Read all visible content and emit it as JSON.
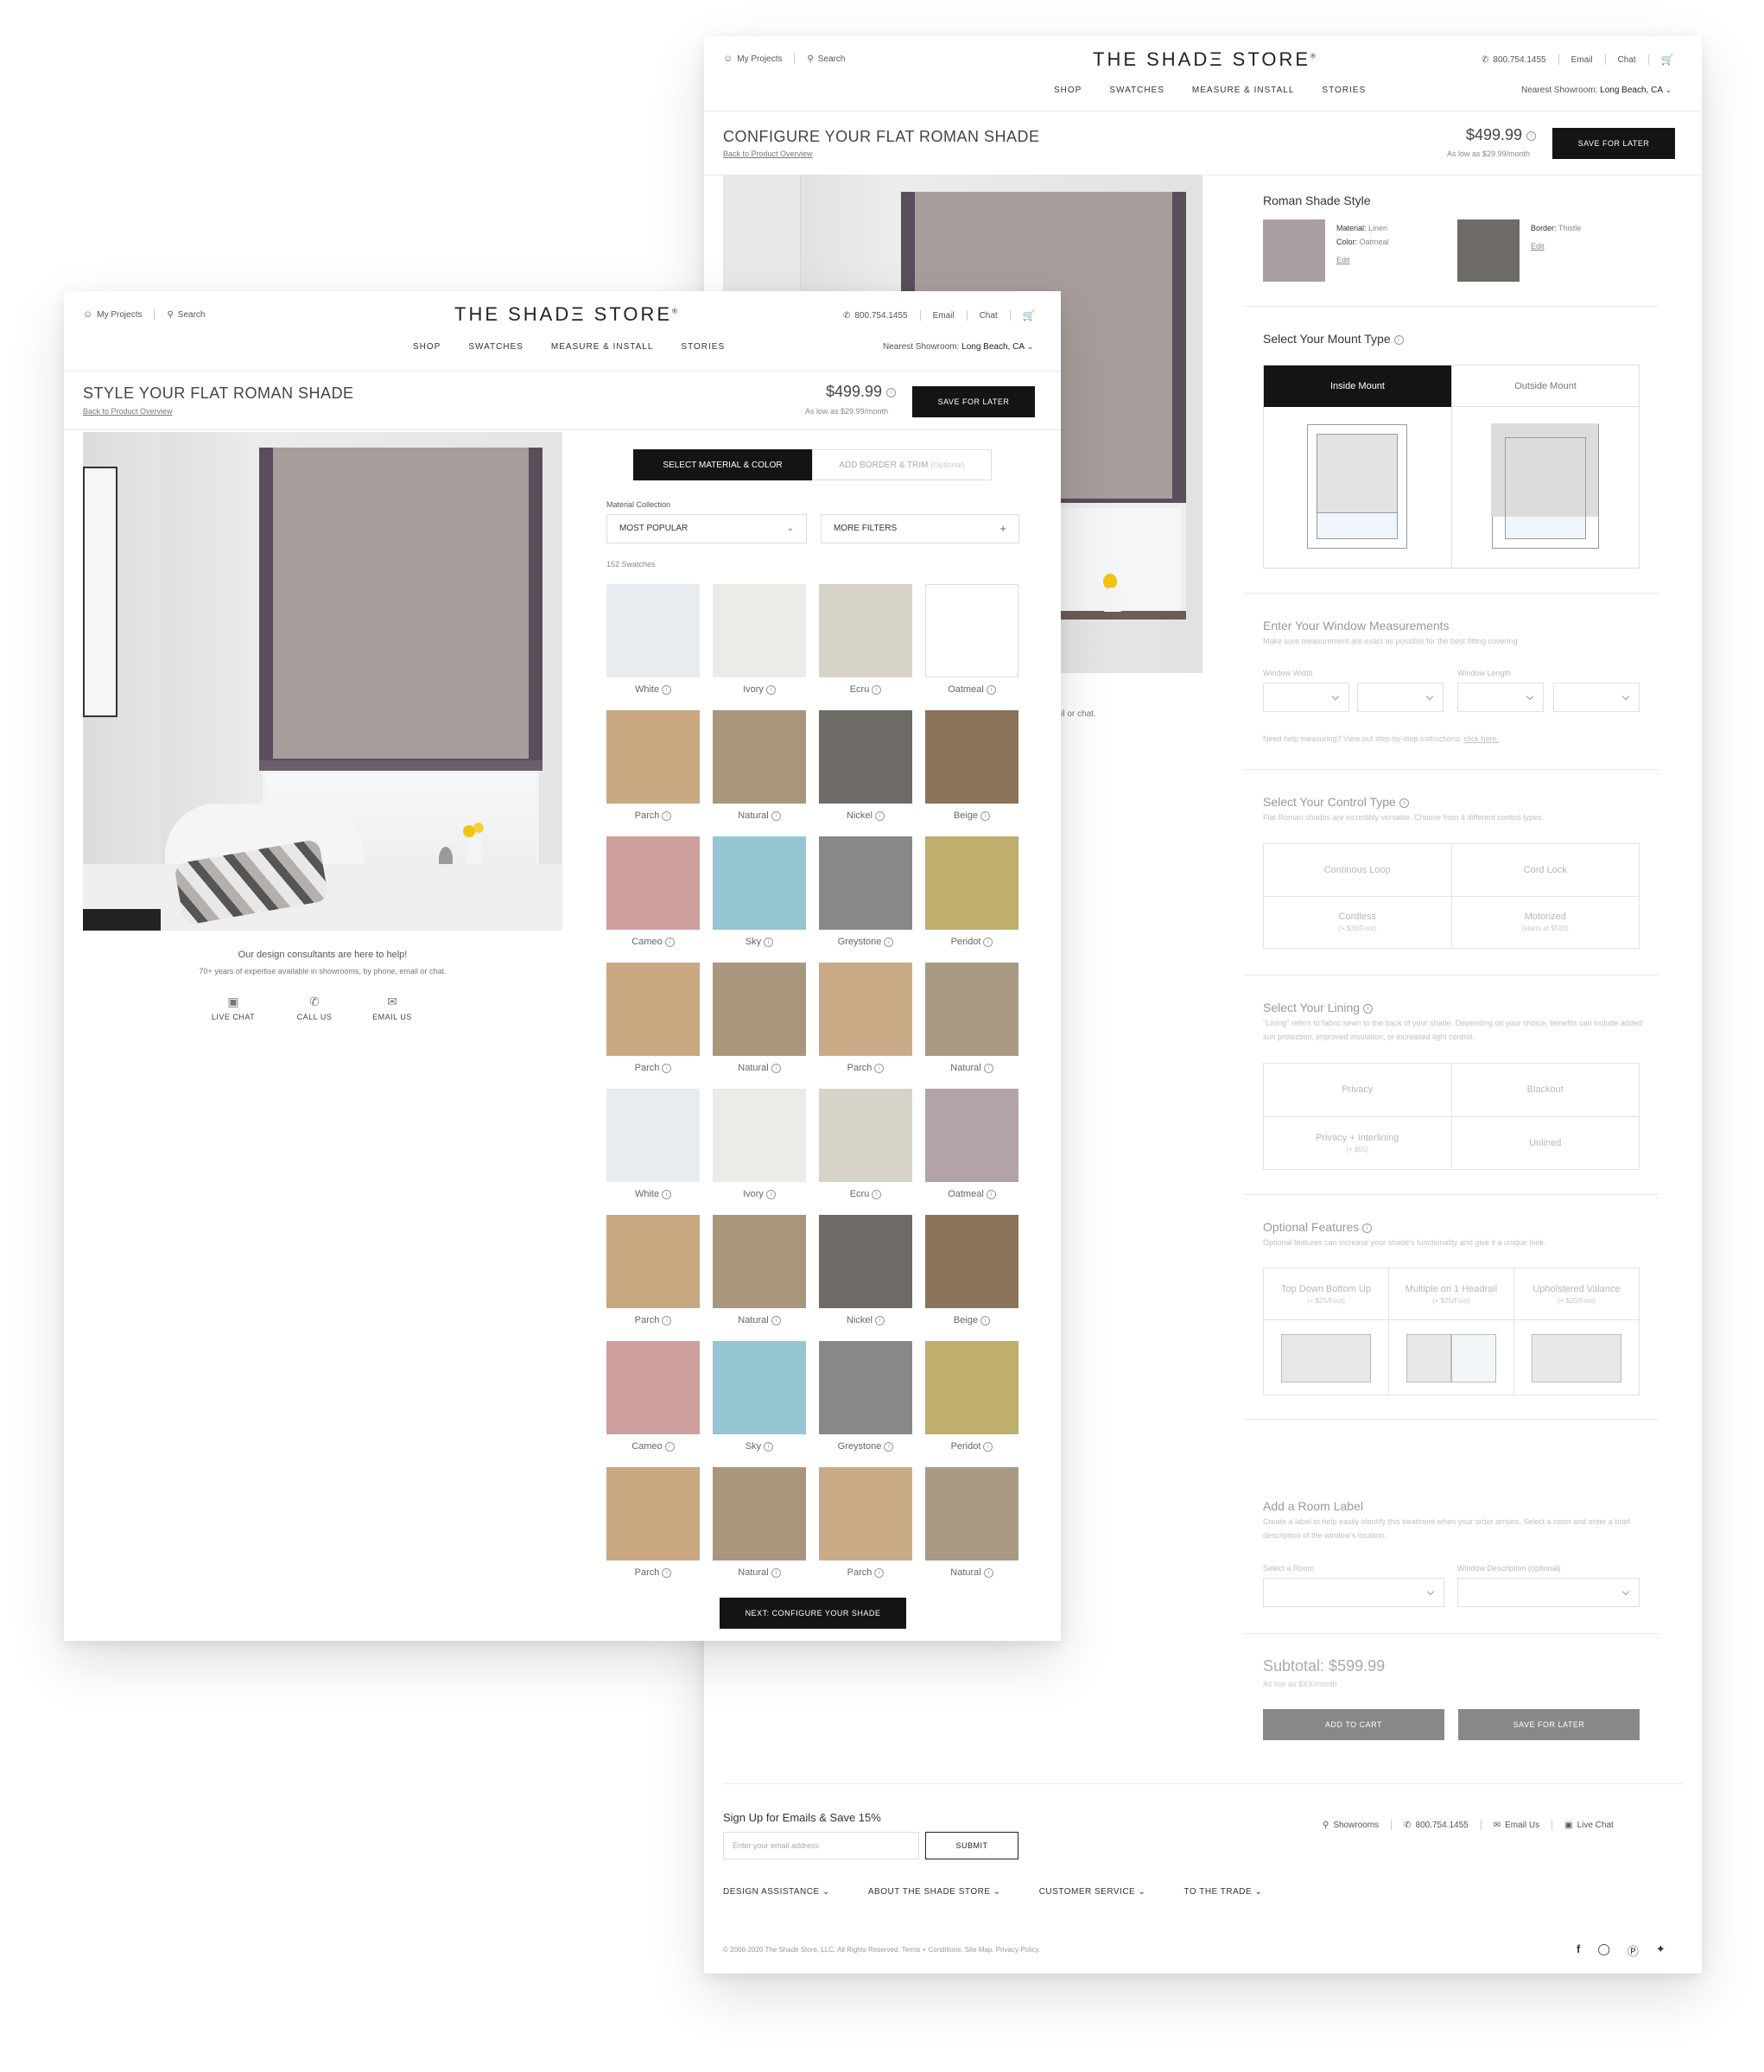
{
  "header": {
    "my_projects": "My Projects",
    "search": "Search",
    "logo": "THE SHADΞ STORE",
    "logo_mark": "®",
    "phone": "800.754.1455",
    "email": "Email",
    "chat": "Chat",
    "nav": [
      "SHOP",
      "SWATCHES",
      "MEASURE & INSTALL",
      "STORIES"
    ],
    "showroom_prefix": "Nearest Showroom:",
    "showroom_name": "Long Beach, CA"
  },
  "config_page": {
    "title": "CONFIGURE YOUR FLAT ROMAN SHADE",
    "back": "Back to Product Overview",
    "price": "$499.99",
    "monthly": "As low as $29.99/month",
    "save_btn": "SAVE FOR LATER",
    "behind_text": "nail or chat.",
    "style": {
      "heading": "Roman Shade Style",
      "material_label": "Material:",
      "material_value": "Linen",
      "color_label": "Color:",
      "color_value": "Oatmeal",
      "edit1": "Edit",
      "border_label": "Border:",
      "border_value": "Thistle",
      "edit2": "Edit"
    },
    "mount": {
      "heading": "Select Your Mount Type",
      "inside": "Inside Mount",
      "outside": "Outside Mount"
    },
    "measure": {
      "heading": "Enter Your Window Measurements",
      "desc": "Make sure measurement are exact as possible for the best fitting covering",
      "width_label": "Window Width",
      "length_label": "Window Length",
      "help": "Need help measuring? View out step-by-step instructions,",
      "help_link": "click here."
    },
    "control": {
      "heading": "Select Your Control Type",
      "desc": "Flat Roman shades are incredibly versatile. Choose from 4 different control types.",
      "options": [
        {
          "label": "Continous Loop",
          "sub": ""
        },
        {
          "label": "Cord Lock",
          "sub": ""
        },
        {
          "label": "Cordless",
          "sub": "(+ $30/Foot)"
        },
        {
          "label": "Motorized",
          "sub": "(starts at $500)"
        }
      ]
    },
    "lining": {
      "heading": "Select Your Lining",
      "desc": "\"Lining\" refers to fabric sewn to the back of your shade. Depending on your choice, benefits can include added sun protection, improved insulation, or increased light control.",
      "options": [
        {
          "label": "Privacy",
          "sub": ""
        },
        {
          "label": "Blackout",
          "sub": ""
        },
        {
          "label": "Privacy + Interlining",
          "sub": "(+ $55)"
        },
        {
          "label": "Unlined",
          "sub": ""
        }
      ]
    },
    "features": {
      "heading": "Optional Features",
      "desc": "Optional features can increase your shade's functionality and give it a unique look.",
      "options": [
        {
          "label": "Top Down Bottom Up",
          "sub": "(+ $25/Foot)"
        },
        {
          "label": "Multiple on 1 Headrail",
          "sub": "(+ $25/Foot)"
        },
        {
          "label": "Upholstered Valance",
          "sub": "(+ $25/Foot)"
        }
      ]
    },
    "room": {
      "heading": "Add a Room Label",
      "desc": "Create a label to help easily identify this treatment when your order arrives. Select a room and enter a brief description of the window's location.",
      "select_label": "Select a Room",
      "desc_label": "Window Description (optional)"
    },
    "subtotal": "Subtotal: $599.99",
    "subtotal_monthly": "As low as $XX/month",
    "add_to_cart": "ADD TO CART",
    "save_for_later": "SAVE FOR LATER",
    "footer": {
      "signup": "Sign Up for Emails & Save 15%",
      "email_placeholder": "Enter your email address",
      "submit": "SUBMIT",
      "showrooms": "Showrooms",
      "phone": "800.754.1455",
      "email_us": "Email Us",
      "live_chat": "Live Chat",
      "links": [
        "DESIGN ASSISTANCE",
        "ABOUT THE SHADE STORE",
        "CUSTOMER SERVICE",
        "TO THE TRADE"
      ],
      "copyright": "© 2006-2020 The Shade Store, LLC. All Rights Reserved. Terms + Conditions. Site Map. Privacy Policy."
    }
  },
  "style_page": {
    "title": "STYLE YOUR FLAT ROMAN SHADE",
    "back": "Back to Product Overview",
    "price": "$499.99",
    "monthly": "As low as $29.99/month",
    "save_btn": "SAVE FOR LATER",
    "tab_material": "SELECT MATERIAL & COLOR",
    "tab_border": "ADD BORDER & TRIM",
    "tab_border_opt": "(Optional)",
    "collection_label": "Material Collection",
    "collection_value": "MOST POPULAR",
    "more_filters": "MORE FILTERS",
    "swatch_count": "152 Swatches",
    "help_title": "Our design consultants are here to help!",
    "help_sub": "70+ years of expertise available in showrooms, by phone, email or chat.",
    "contact": [
      "LIVE CHAT",
      "CALL US",
      "EMAIL US"
    ],
    "next_btn": "NEXT: CONFIGURE YOUR SHADE",
    "swatches": [
      {
        "name": "White",
        "color": "#e8ecf1"
      },
      {
        "name": "Ivory",
        "color": "#ebebe8"
      },
      {
        "name": "Ecru",
        "color": "#d8d3c8"
      },
      {
        "name": "Oatmeal",
        "color": "#ffffff"
      },
      {
        "name": "Parch",
        "color": "#c9a882"
      },
      {
        "name": "Natural",
        "color": "#a8977d"
      },
      {
        "name": "Nickel",
        "color": "#6e6b67"
      },
      {
        "name": "Beige",
        "color": "#8b735a"
      },
      {
        "name": "Cameo",
        "color": "#cf9f9e"
      },
      {
        "name": "Sky",
        "color": "#94c6d4"
      },
      {
        "name": "Greystone",
        "color": "#88888a"
      },
      {
        "name": "Peridot",
        "color": "#c0ae6c"
      },
      {
        "name": "Parch",
        "color": "#c9a882"
      },
      {
        "name": "Natural",
        "color": "#a8977d"
      },
      {
        "name": "Parch",
        "color": "#c9ab88"
      },
      {
        "name": "Natural",
        "color": "#a89a83"
      },
      {
        "name": "White",
        "color": "#e8ecf1"
      },
      {
        "name": "Ivory",
        "color": "#ebebe8"
      },
      {
        "name": "Ecru",
        "color": "#d8d3c8"
      },
      {
        "name": "Oatmeal",
        "color": "#b3a3a8"
      },
      {
        "name": "Parch",
        "color": "#c9a882"
      },
      {
        "name": "Natural",
        "color": "#a8977d"
      },
      {
        "name": "Nickel",
        "color": "#6e6b67"
      },
      {
        "name": "Beige",
        "color": "#8b735a"
      },
      {
        "name": "Cameo",
        "color": "#cf9f9e"
      },
      {
        "name": "Sky",
        "color": "#94c6d4"
      },
      {
        "name": "Greystone",
        "color": "#88888a"
      },
      {
        "name": "Peridot",
        "color": "#c0ae6c"
      },
      {
        "name": "Parch",
        "color": "#c9a882"
      },
      {
        "name": "Natural",
        "color": "#a8977d"
      },
      {
        "name": "Parch",
        "color": "#c9ab88"
      },
      {
        "name": "Natural",
        "color": "#a89a83"
      }
    ]
  },
  "colors": {
    "shade_fabric": "#a79d9b",
    "shade_border": "#5a4e5c",
    "dark_button": "#141414"
  }
}
